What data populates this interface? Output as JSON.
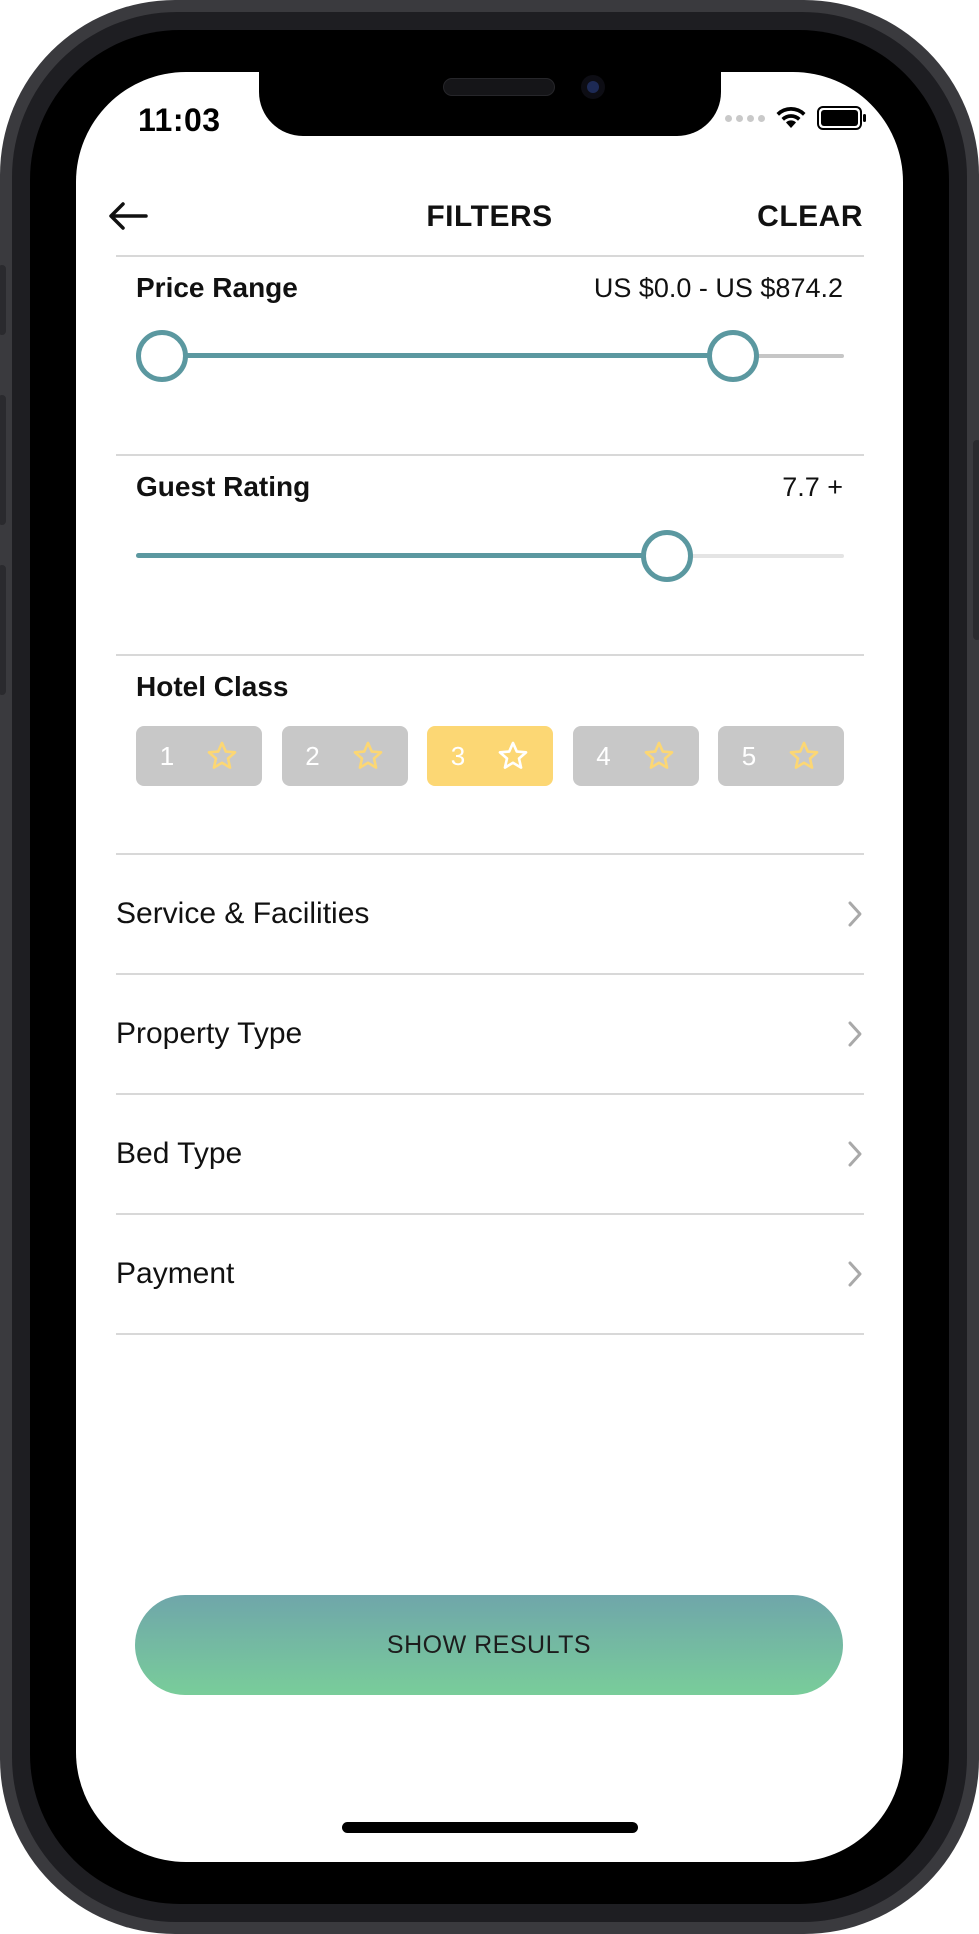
{
  "status_bar": {
    "time": "11:03",
    "icons": [
      "signal-icon",
      "wifi-icon",
      "battery-icon"
    ]
  },
  "header": {
    "title": "FILTERS",
    "clear_label": "CLEAR",
    "back_icon": "arrow-left-icon"
  },
  "price_range": {
    "title": "Price Range",
    "value_text": "US $0.0 - US $874.2",
    "low_fraction": 0.0,
    "high_fraction": 0.87
  },
  "guest_rating": {
    "title": "Guest Rating",
    "value_text": "7.7 +",
    "fraction": 0.77
  },
  "hotel_class": {
    "title": "Hotel Class",
    "options": [
      {
        "label": "1",
        "selected": false
      },
      {
        "label": "2",
        "selected": false
      },
      {
        "label": "3",
        "selected": true
      },
      {
        "label": "4",
        "selected": false
      },
      {
        "label": "5",
        "selected": false
      }
    ],
    "star_color": "#fcd774"
  },
  "list": [
    {
      "label": "Service & Facilities"
    },
    {
      "label": "Property Type"
    },
    {
      "label": "Bed Type"
    },
    {
      "label": "Payment"
    }
  ],
  "show_results_label": "SHOW RESULTS",
  "colors": {
    "accent": "#5b98a0",
    "chip_selected": "#fcd774",
    "chip_default": "#c8c8c8",
    "button_gradient_top": "#6fa6aa",
    "button_gradient_bottom": "#79cd9a"
  }
}
